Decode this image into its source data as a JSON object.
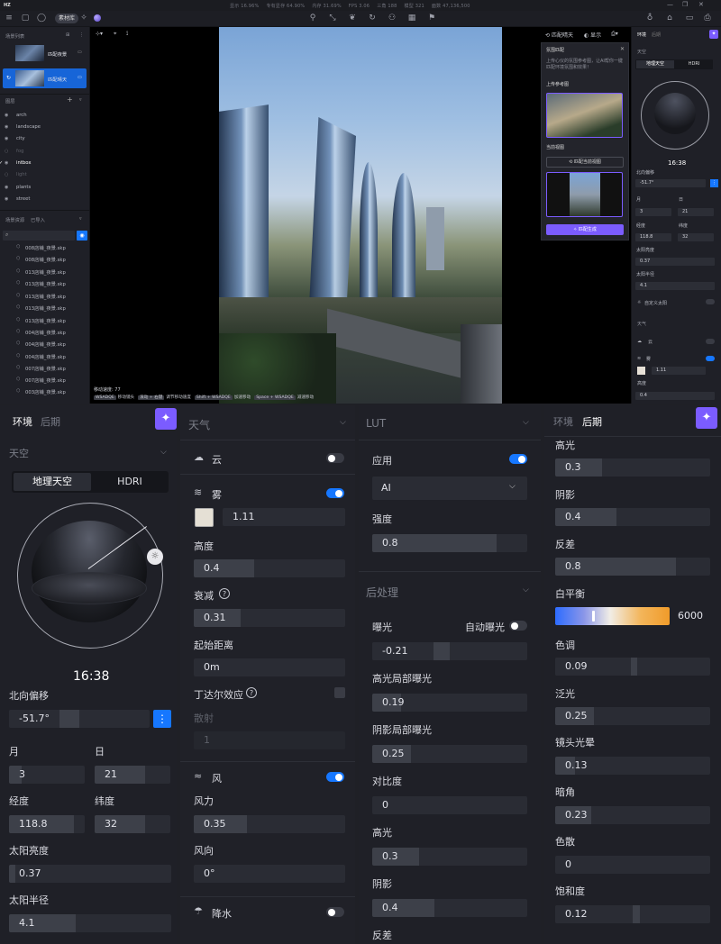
{
  "app": {
    "title": "HZ",
    "stats": [
      "显示 16.96%",
      "专有显存 64.90%",
      "内存 31.69%",
      "FPS 3.06",
      "三角 188",
      "模型 321",
      "面数 47,136,500"
    ],
    "material_btn": "素材库"
  },
  "left": {
    "scene_list_title": "场景列表",
    "scenes": [
      {
        "name": "匹配夜景"
      },
      {
        "name": "匹配晴天"
      }
    ],
    "layers_title": "图层",
    "layers": [
      "arch",
      "landscape",
      "city",
      "fog",
      "intbox",
      "light",
      "plants",
      "street"
    ],
    "resources_title": "场景资源",
    "resources_import": "已导入",
    "resources": [
      "008店铺_夜景.skp",
      "008店铺_夜景.skp",
      "013店铺_夜景.skp",
      "013店铺_夜景.skp",
      "013店铺_夜景.skp",
      "013店铺_夜景.skp",
      "013店铺_夜景.skp",
      "004店铺_夜景.skp",
      "004店铺_夜景.skp",
      "004店铺_夜景.skp",
      "007店铺_夜景.skp",
      "007店铺_夜景.skp",
      "003店铺_夜景.skp",
      "003店铺_夜景.skp"
    ]
  },
  "viewport": {
    "speed": "移动速度: 77",
    "hints": [
      "WSADQE",
      "移动镜头",
      "滚动 + 右键",
      "调节移动速度",
      "Shift + WSADQE",
      "加速移动",
      "Space + WSADQE",
      "减速移动"
    ],
    "match_btn": "匹配晴天",
    "display": "显示"
  },
  "match_panel": {
    "title": "氛围匹配",
    "desc": "上传心仪的氛围参考图，让AI帮你一键匹配环境氛围和效果！",
    "ref_label": "上传参考图",
    "cur_label": "当前视图",
    "match_view_btn": "匹配当前视图",
    "generate_btn": "匹配生成"
  },
  "mini": {
    "tab_env": "环境",
    "tab_post": "后期",
    "sky": "天空",
    "geo": "地理天空",
    "hdri": "HDRI",
    "time": "16:38",
    "north": "北向偏移",
    "north_val": "-51.7°",
    "month": "月",
    "day": "日",
    "month_val": "3",
    "day_val": "21",
    "lon": "经度",
    "lat": "纬度",
    "lon_val": "118.8",
    "lat_val": "32",
    "sun_b": "太阳亮度",
    "sun_b_val": "0.37",
    "sun_r": "太阳半径",
    "sun_r_val": "4.1",
    "custom_sun": "自定义太阳",
    "weather": "天气",
    "cloud": "云",
    "fog": "雾",
    "fog_val": "1.11",
    "height": "高度",
    "height_val": "0.4"
  },
  "env": {
    "tab_env": "环境",
    "tab_post": "后期",
    "sky_title": "天空",
    "geo_sky": "地理天空",
    "hdri": "HDRI",
    "time": "16:38",
    "north_label": "北向偏移",
    "north_val": "-51.7°",
    "month_label": "月",
    "month_val": "3",
    "day_label": "日",
    "day_val": "21",
    "lon_label": "经度",
    "lon_val": "118.8",
    "lat_label": "纬度",
    "lat_val": "32",
    "sun_bright_label": "太阳亮度",
    "sun_bright_val": "0.37",
    "sun_radius_label": "太阳半径",
    "sun_radius_val": "4.1"
  },
  "weather": {
    "title": "天气",
    "cloud": "云",
    "fog": "雾",
    "fog_density": "1.11",
    "height_label": "高度",
    "height_val": "0.4",
    "decay_label": "衰减",
    "decay_val": "0.31",
    "start_label": "起始距离",
    "start_val": "0m",
    "tyndall_label": "丁达尔效应",
    "scatter_label": "散射",
    "scatter_val": "1",
    "wind": "风",
    "wind_force_label": "风力",
    "wind_force_val": "0.35",
    "wind_dir_label": "风向",
    "wind_dir_val": "0°",
    "rain": "降水"
  },
  "lut": {
    "title": "LUT",
    "apply": "应用",
    "select": "AI",
    "strength_label": "强度",
    "strength_val": "0.8"
  },
  "post": {
    "title": "后处理",
    "exposure": "曝光",
    "auto_exposure": "自动曝光",
    "exposure_val": "-0.21",
    "hl_exp": "高光局部曝光",
    "hl_exp_val": "0.19",
    "sh_exp": "阴影局部曝光",
    "sh_exp_val": "0.25",
    "contrast": "对比度",
    "contrast_val": "0",
    "highlight": "高光",
    "highlight_val": "0.3",
    "shadow": "阴影",
    "shadow_val": "0.4",
    "diff": "反差"
  },
  "post_right": {
    "tab_env": "环境",
    "tab_post": "后期",
    "highlight": "高光",
    "highlight_val": "0.3",
    "shadow": "阴影",
    "shadow_val": "0.4",
    "diff": "反差",
    "diff_val": "0.8",
    "wb": "白平衡",
    "wb_val": "6000",
    "tint": "色调",
    "tint_val": "0.09",
    "bloom": "泛光",
    "bloom_val": "0.25",
    "flare": "镜头光晕",
    "flare_val": "0.13",
    "vignette": "暗角",
    "vignette_val": "0.23",
    "ca": "色散",
    "ca_val": "0",
    "saturation": "饱和度",
    "saturation_val": "0.12"
  }
}
